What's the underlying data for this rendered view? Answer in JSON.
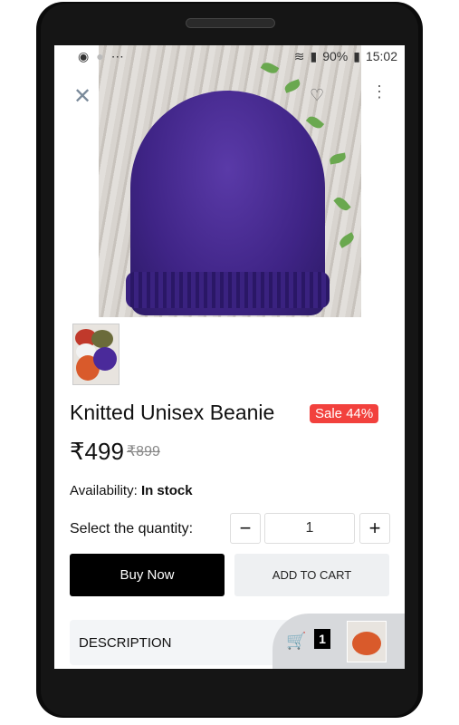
{
  "status_bar": {
    "battery": "90%",
    "time": "15:02"
  },
  "product": {
    "title": "Knitted Unisex Beanie",
    "sale_badge": "Sale 44%",
    "price": "₹499",
    "old_price": "₹899",
    "availability_label": "Availability:",
    "availability_value": "In stock"
  },
  "quantity": {
    "label": "Select the quantity:",
    "value": "1",
    "minus": "−",
    "plus": "+"
  },
  "actions": {
    "buy_now": "Buy Now",
    "add_to_cart": "ADD TO CART"
  },
  "sections": {
    "description": "DESCRIPTION"
  },
  "cart": {
    "count": "1"
  },
  "icons": {
    "close": "close-icon",
    "favorite": "heart-icon",
    "more": "more-vert-icon",
    "cart": "add-to-cart-icon"
  },
  "colors": {
    "sale": "#f2413d",
    "primary_button": "#000000"
  }
}
